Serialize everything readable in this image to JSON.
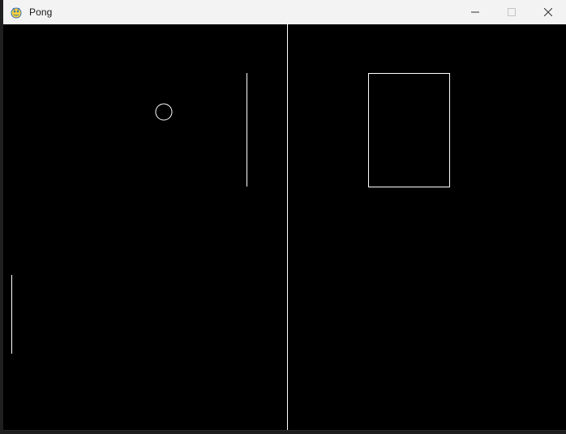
{
  "window": {
    "title": "Pong",
    "app_icon": "pygame-snake-icon",
    "controls": {
      "minimize_icon": "minimize-icon",
      "maximize_icon": "maximize-icon",
      "close_icon": "close-icon"
    }
  },
  "colors": {
    "game_background": "#000000",
    "stroke": "#ffffff",
    "titlebar_background": "#f3f3f3",
    "titlebar_text": "#1a1a1a"
  },
  "game": {
    "objects": [
      "ball",
      "left-paddle",
      "right-paddle",
      "center-net-line",
      "rectangle-outline"
    ]
  }
}
